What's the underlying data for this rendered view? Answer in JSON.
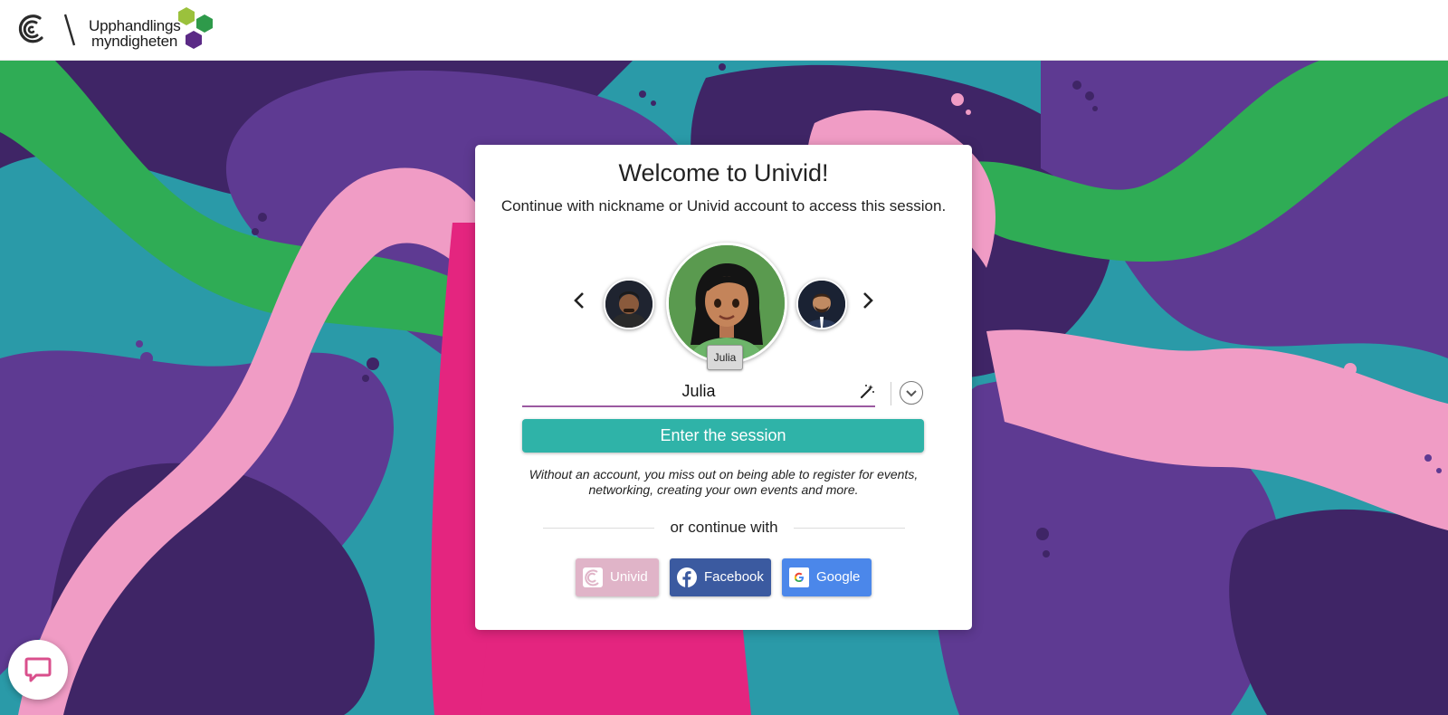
{
  "header": {
    "platform_logo": "univid-logo-icon",
    "partner_logo_lines": [
      "Upphandlings",
      "myndigheten"
    ],
    "partner_logo_colors": [
      "#9bc13c",
      "#2e9a4a",
      "#5b2a86"
    ]
  },
  "background": {
    "colors": [
      "#2a9aa8",
      "#5e3a92",
      "#3f2566",
      "#f09cc5",
      "#2fac55",
      "#e4257f"
    ]
  },
  "card": {
    "title": "Welcome to Univid!",
    "subtitle": "Continue with nickname or Univid account to access this session.",
    "avatar": {
      "selected_name": "Julia",
      "prev_icon": "chevron-left-icon",
      "next_icon": "chevron-right-icon"
    },
    "nickname": {
      "value": "Julia",
      "randomize_icon": "magic-wand-icon",
      "expand_icon": "chevron-down-icon"
    },
    "enter_button": "Enter the session",
    "disclaimer": "Without an account, you miss out on being able to register for events, networking, creating your own events and more.",
    "or_continue": "or continue with",
    "social": [
      {
        "label": "Univid",
        "icon": "univid-icon",
        "color": "#e0b4c8"
      },
      {
        "label": "Facebook",
        "icon": "facebook-icon",
        "color": "#3b5aa0"
      },
      {
        "label": "Google",
        "icon": "google-icon",
        "color": "#4b87ea"
      }
    ]
  },
  "chat": {
    "icon": "chat-bubble-icon"
  }
}
